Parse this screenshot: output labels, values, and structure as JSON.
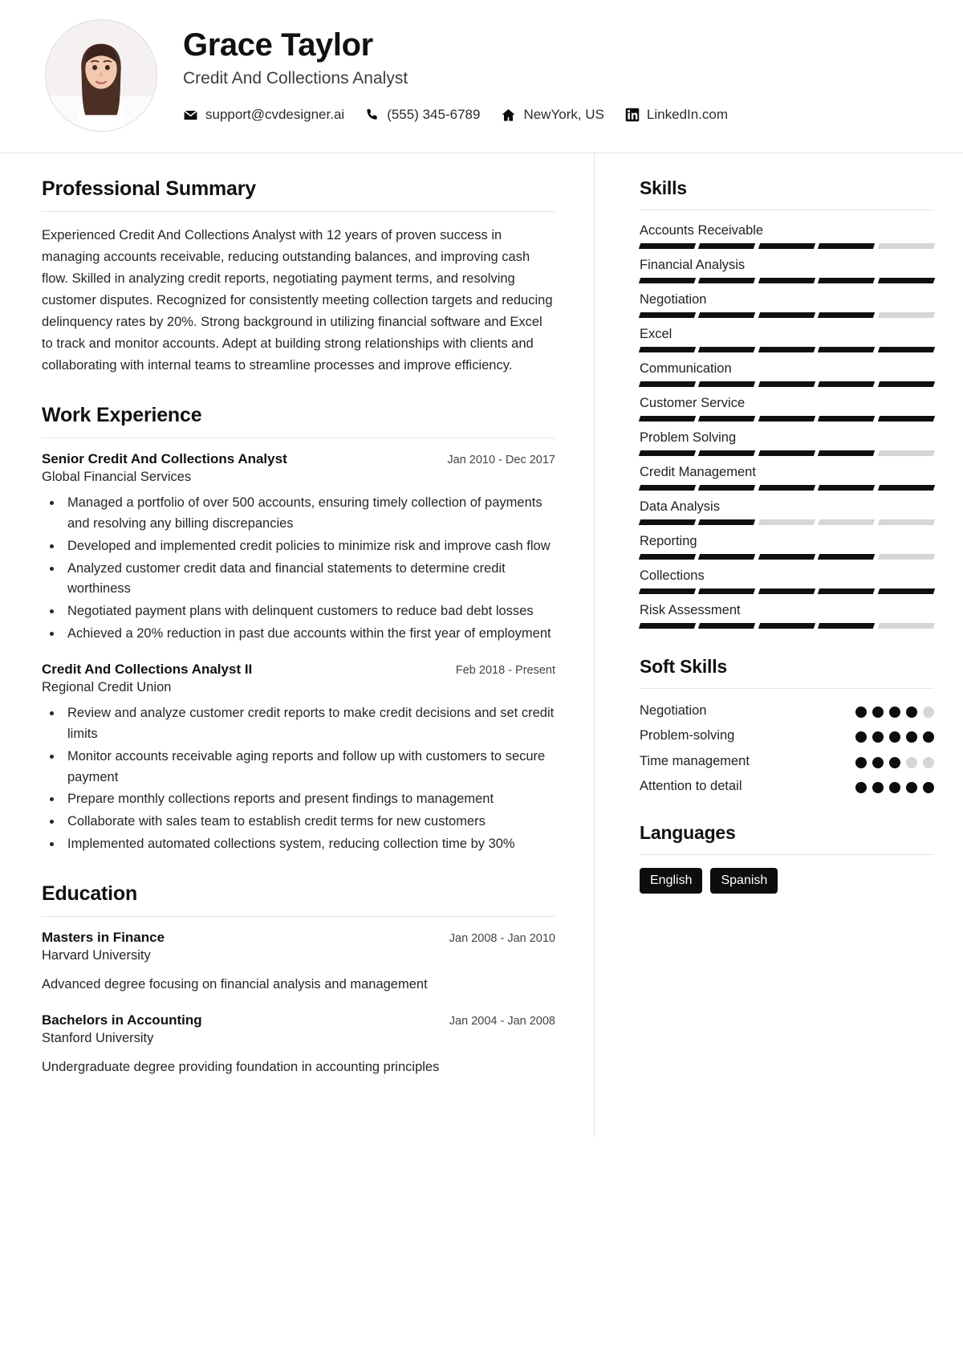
{
  "header": {
    "name": "Grace Taylor",
    "job_title": "Credit And Collections Analyst",
    "avatar_alt": "profile-photo",
    "contacts": [
      {
        "icon": "envelope-icon",
        "value": "support@cvdesigner.ai"
      },
      {
        "icon": "phone-icon",
        "value": "(555) 345-6789"
      },
      {
        "icon": "home-icon",
        "value": "NewYork, US"
      },
      {
        "icon": "linkedin-icon",
        "value": "LinkedIn.com"
      }
    ]
  },
  "main": {
    "summary": {
      "heading": "Professional Summary",
      "text": "Experienced Credit And Collections Analyst with 12 years of proven success in managing accounts receivable, reducing outstanding balances, and improving cash flow. Skilled in analyzing credit reports, negotiating payment terms, and resolving customer disputes. Recognized for consistently meeting collection targets and reducing delinquency rates by 20%. Strong background in utilizing financial software and Excel to track and monitor accounts. Adept at building strong relationships with clients and collaborating with internal teams to streamline processes and improve efficiency."
    },
    "experience": {
      "heading": "Work Experience",
      "entries": [
        {
          "role": "Senior Credit And Collections Analyst",
          "date": "Jan 2010 - Dec 2017",
          "organization": "Global Financial Services",
          "bullets": [
            "Managed a portfolio of over 500 accounts, ensuring timely collection of payments and resolving any billing discrepancies",
            "Developed and implemented credit policies to minimize risk and improve cash flow",
            "Analyzed customer credit data and financial statements to determine credit worthiness",
            "Negotiated payment plans with delinquent customers to reduce bad debt losses",
            "Achieved a 20% reduction in past due accounts within the first year of employment"
          ]
        },
        {
          "role": "Credit And Collections Analyst II",
          "date": "Feb 2018 - Present",
          "organization": "Regional Credit Union",
          "bullets": [
            "Review and analyze customer credit reports to make credit decisions and set credit limits",
            "Monitor accounts receivable aging reports and follow up with customers to secure payment",
            "Prepare monthly collections reports and present findings to management",
            "Collaborate with sales team to establish credit terms for new customers",
            "Implemented automated collections system, reducing collection time by 30%"
          ]
        }
      ]
    },
    "education": {
      "heading": "Education",
      "entries": [
        {
          "degree": "Masters in Finance",
          "date": "Jan 2008 - Jan 2010",
          "school": "Harvard University",
          "description": "Advanced degree focusing on financial analysis and management"
        },
        {
          "degree": "Bachelors in Accounting",
          "date": "Jan 2004 - Jan 2008",
          "school": "Stanford University",
          "description": "Undergraduate degree providing foundation in accounting principles"
        }
      ]
    }
  },
  "sidebar": {
    "skills": {
      "heading": "Skills",
      "max_level": 5,
      "items": [
        {
          "name": "Accounts Receivable",
          "level": 4
        },
        {
          "name": "Financial Analysis",
          "level": 5
        },
        {
          "name": "Negotiation",
          "level": 4
        },
        {
          "name": "Excel",
          "level": 5
        },
        {
          "name": "Communication",
          "level": 5
        },
        {
          "name": "Customer Service",
          "level": 5
        },
        {
          "name": "Problem Solving",
          "level": 4
        },
        {
          "name": "Credit Management",
          "level": 5
        },
        {
          "name": "Data Analysis",
          "level": 2
        },
        {
          "name": "Reporting",
          "level": 4
        },
        {
          "name": "Collections",
          "level": 5
        },
        {
          "name": "Risk Assessment",
          "level": 4
        }
      ]
    },
    "soft_skills": {
      "heading": "Soft Skills",
      "max_level": 5,
      "items": [
        {
          "name": "Negotiation",
          "level": 4
        },
        {
          "name": "Problem-solving",
          "level": 5
        },
        {
          "name": "Time management",
          "level": 3
        },
        {
          "name": "Attention to detail",
          "level": 5
        }
      ]
    },
    "languages": {
      "heading": "Languages",
      "items": [
        "English",
        "Spanish"
      ]
    }
  },
  "colors": {
    "accent": "#0d0d0d",
    "muted_track": "#d6d6d6",
    "rule": "#e6e6e6",
    "text": "#222222"
  }
}
